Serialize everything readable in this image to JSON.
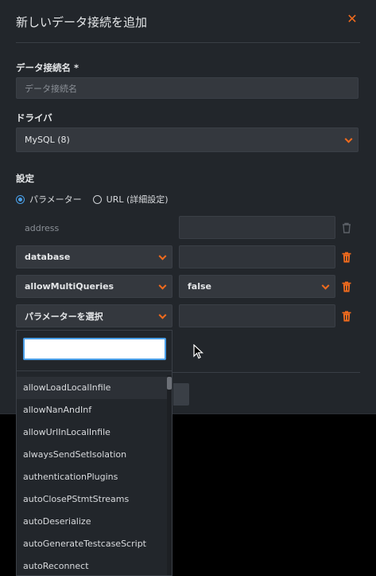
{
  "dialog": {
    "title": "新しいデータ接続を追加",
    "close_icon": "close-icon",
    "name_label": "データ接続名 *",
    "name_placeholder": "データ接続名",
    "driver_label": "ドライバ",
    "driver_value": "MySQL (8)",
    "settings_label": "設定",
    "mode_parameters": "パラメーター",
    "mode_url": "URL (詳細設定)",
    "mode_selected": "parameters",
    "params": [
      {
        "key": "address",
        "value": "",
        "is_placeholder": true,
        "has_dropdown": false
      },
      {
        "key": "database",
        "value": "",
        "has_dropdown": true
      },
      {
        "key": "allowMultiQueries",
        "value": "false",
        "has_dropdown": true
      },
      {
        "key": "パラメーターを選択",
        "value": "",
        "has_dropdown": true
      }
    ]
  },
  "dropdown": {
    "search_value": "",
    "items": [
      "allowLoadLocalInfile",
      "allowNanAndInf",
      "allowUrlInLocalInfile",
      "alwaysSendSetIsolation",
      "authenticationPlugins",
      "autoClosePStmtStreams",
      "autoDeserialize",
      "autoGenerateTestcaseScript",
      "autoReconnect"
    ],
    "hovered_index": 0
  },
  "colors": {
    "accent": "#f26b1d",
    "selection_blue": "#4a9fe8",
    "panel_bg": "#22262b",
    "field_bg": "#34383e"
  }
}
